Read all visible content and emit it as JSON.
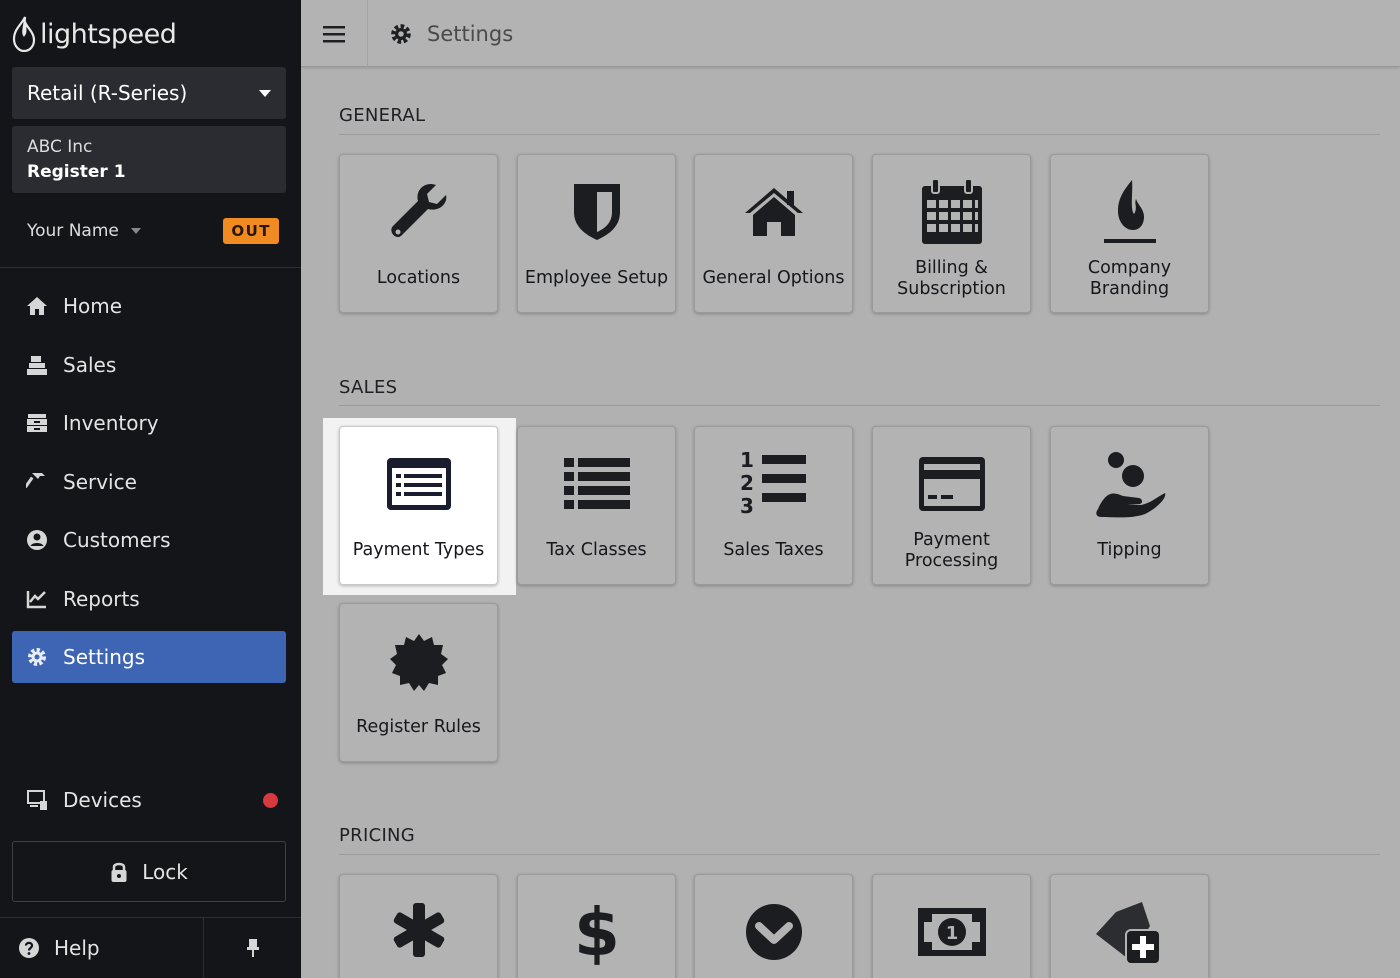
{
  "brand": {
    "name": "lightspeed"
  },
  "sidebar": {
    "product": "Retail (R-Series)",
    "company": "ABC Inc",
    "register": "Register 1",
    "user": "Your Name",
    "clock_status": "OUT",
    "nav": [
      {
        "label": "Home",
        "icon": "home-icon"
      },
      {
        "label": "Sales",
        "icon": "register-icon"
      },
      {
        "label": "Inventory",
        "icon": "inventory-icon"
      },
      {
        "label": "Service",
        "icon": "hammer-icon"
      },
      {
        "label": "Customers",
        "icon": "user-circle-icon"
      },
      {
        "label": "Reports",
        "icon": "chart-icon"
      },
      {
        "label": "Settings",
        "icon": "gear-icon",
        "active": true
      }
    ],
    "devices": "Devices",
    "lock": "Lock",
    "help": "Help"
  },
  "topbar": {
    "title": "Settings"
  },
  "sections": {
    "general": {
      "title": "GENERAL",
      "tiles": [
        {
          "label": "Locations",
          "icon": "wrench-icon"
        },
        {
          "label": "Employee Setup",
          "icon": "shield-icon"
        },
        {
          "label": "General Options",
          "icon": "home-icon"
        },
        {
          "label": "Billing & Subscription",
          "icon": "calendar-icon"
        },
        {
          "label": "Company Branding",
          "icon": "flame-icon"
        }
      ]
    },
    "sales": {
      "title": "SALES",
      "tiles": [
        {
          "label": "Payment Types",
          "icon": "list-card-icon",
          "selected": true
        },
        {
          "label": "Tax Classes",
          "icon": "list-icon"
        },
        {
          "label": "Sales Taxes",
          "icon": "numbered-list-icon"
        },
        {
          "label": "Payment Processing",
          "icon": "credit-card-icon"
        },
        {
          "label": "Tipping",
          "icon": "hand-coins-icon"
        },
        {
          "label": "Register Rules",
          "icon": "badge-icon"
        }
      ]
    },
    "pricing": {
      "title": "PRICING",
      "tiles": [
        {
          "label": "",
          "icon": "asterisk-icon"
        },
        {
          "label": "",
          "icon": "dollar-icon"
        },
        {
          "label": "",
          "icon": "chevron-circle-icon"
        },
        {
          "label": "",
          "icon": "banknote-icon"
        },
        {
          "label": "",
          "icon": "tag-plus-icon"
        }
      ]
    }
  },
  "colors": {
    "sidebar_bg": "#141519",
    "active_nav": "#3e65b4",
    "out_badge": "#f08b22",
    "alert_dot": "#d6393f",
    "content_bg": "#b1b1b1"
  }
}
